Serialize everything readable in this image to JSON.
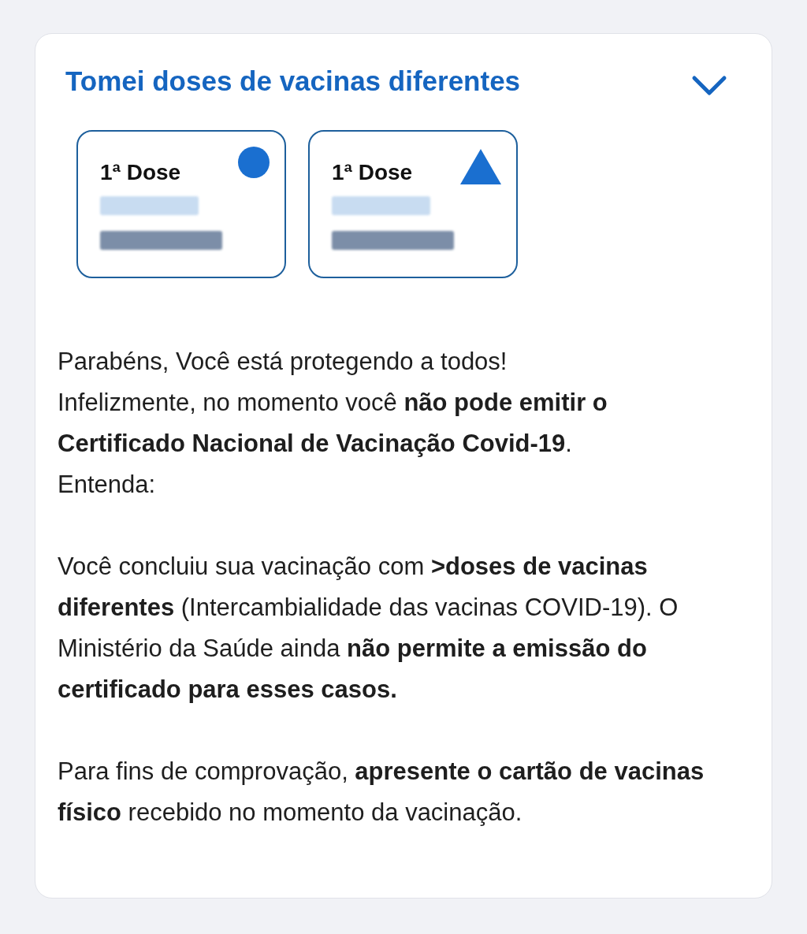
{
  "panel": {
    "title": "Tomei doses de vacinas diferentes",
    "doses": [
      {
        "label": "1ª Dose",
        "kind": "circle"
      },
      {
        "label": "1ª Dose",
        "kind": "triangle"
      }
    ],
    "paragraphs": [
      [
        "Parabéns, Você está protegendo a todos!",
        "Infelizmente, no momento você **não pode emitir o Certificado Nacional de Vacinação Covid-19**.",
        "Entenda:"
      ],
      [
        "Você concluiu sua vacinação com **>doses de vacinas diferentes** (Intercambialidade das vacinas COVID-19). O Ministério da Saúde ainda **não permite a emissão do certificado para esses casos.**"
      ],
      [
        "Para fins de comprovação, **apresente o cartão de vacinas físico** recebido no momento da vacinação."
      ]
    ]
  }
}
